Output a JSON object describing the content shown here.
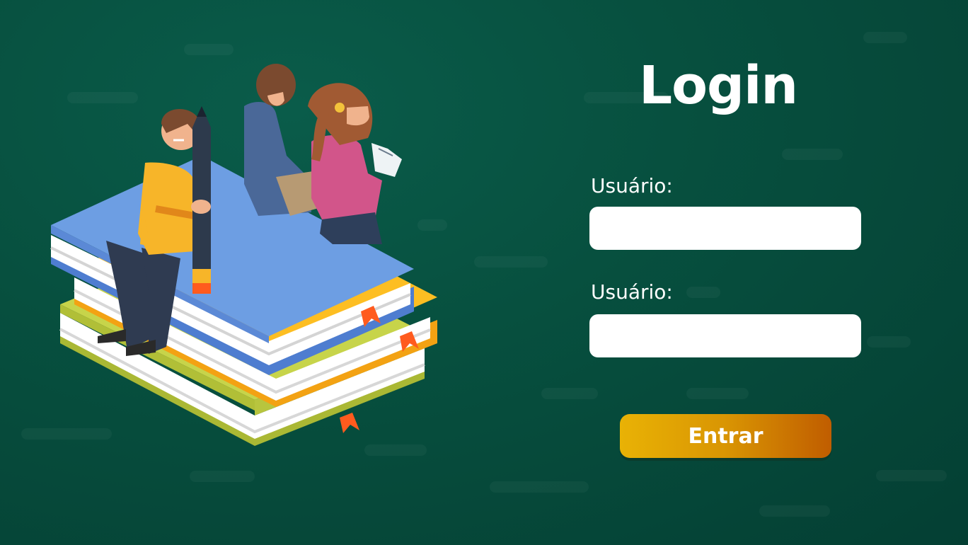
{
  "login": {
    "title": "Login",
    "username_label": "Usuário:",
    "second_label": "Usuário:",
    "username_value": "",
    "second_value": "",
    "submit_label": "Entrar"
  },
  "colors": {
    "background": "#07503f",
    "button_start": "#e9b205",
    "button_end": "#c05d00",
    "input_bg": "#ffffff",
    "text": "#ffffff"
  }
}
